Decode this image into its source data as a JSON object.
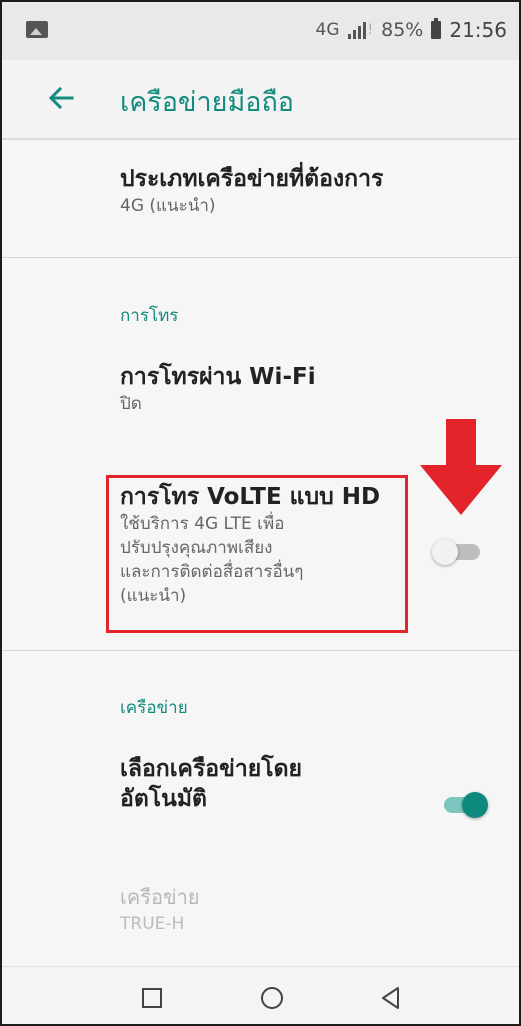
{
  "status_bar": {
    "network": "4G",
    "battery": "85%",
    "time": "21:56"
  },
  "toolbar": {
    "title": "เครือข่ายมือถือ"
  },
  "settings": {
    "preferred_network": {
      "title": "ประเภทเครือข่ายที่ต้องการ",
      "subtitle": "4G (แนะนำ)"
    },
    "calls_section_header": "การโทร",
    "wifi_calling": {
      "title": "การโทรผ่าน Wi-Fi",
      "subtitle": "ปิด"
    },
    "volte_hd": {
      "title": "การโทร VoLTE แบบ HD",
      "subtitle_lines": [
        "ใช้บริการ 4G LTE เพื่อ",
        "ปรับปรุงคุณภาพเสียง",
        "และการติดต่อสื่อสารอื่นๆ",
        "(แนะนำ)"
      ],
      "enabled": false
    },
    "network_section_header": "เครือข่าย",
    "auto_select": {
      "title_lines": [
        "เลือกเครือข่ายโดย",
        "อัตโนมัติ"
      ],
      "enabled": true
    },
    "network": {
      "title": "เครือข่าย",
      "subtitle": "TRUE-H"
    }
  },
  "annotation": {
    "highlight_color": "#e3242b",
    "arrow_color": "#e3242b"
  },
  "colors": {
    "accent": "#138b7f",
    "toggle_on": "#0e8a7c"
  },
  "nav_icons": [
    "square-recents-icon",
    "circle-home-icon",
    "triangle-back-icon"
  ]
}
